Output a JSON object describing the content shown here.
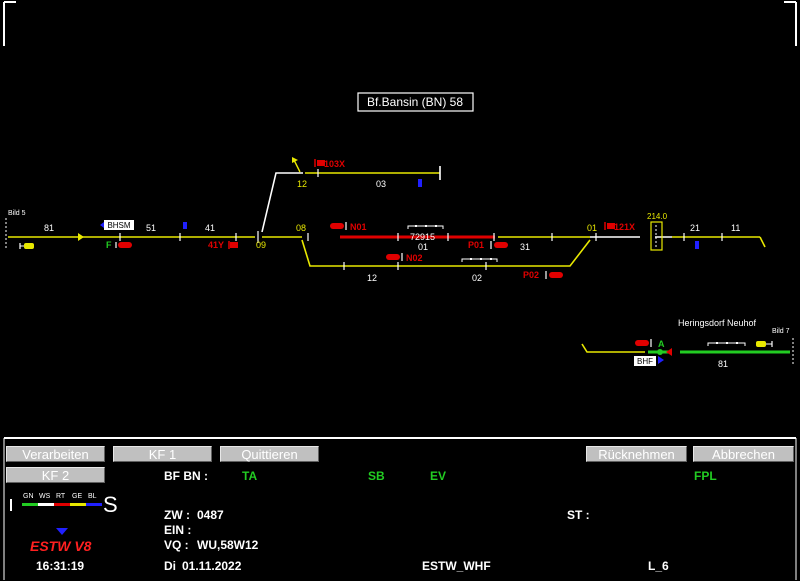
{
  "station_title": "Bf.Bansin (BN) 58",
  "bild_left": "Bild 5",
  "bild_right": "Bild 7",
  "heringsdorf_label": "Heringsdorf Neuhof",
  "track_numbers": {
    "t81": "81",
    "t51": "51",
    "t41": "41",
    "t09": "09",
    "t08": "08",
    "t12u": "12",
    "t03": "03",
    "t72915": "72915",
    "t01c": "01",
    "t31": "31",
    "t12l": "12",
    "t02": "02",
    "t01r": "01",
    "t214": "214.0",
    "t21": "21",
    "t11": "11",
    "t81r": "81"
  },
  "signals": {
    "s103x": "103X",
    "sn01": "N01",
    "sn02": "N02",
    "sp01": "P01",
    "sp02": "P02",
    "s41y": "41Y",
    "sf": "F",
    "s121x": "121X",
    "sa": "A"
  },
  "boxes": {
    "bhsm": "BHSM",
    "bhf": "BHF"
  },
  "buttons": {
    "verarbeiten": "Verarbeiten",
    "kf1": "KF 1",
    "quittieren": "Quittieren",
    "ruecknehmen": "Rücknehmen",
    "abbrechen": "Abbrechen",
    "kf2": "KF 2"
  },
  "status": {
    "bf_label": "BF BN :",
    "ta": "TA",
    "sb": "SB",
    "ev": "EV",
    "fpl": "FPL",
    "zw_label": "ZW :",
    "zw_value": "0487",
    "st_label": "ST :",
    "ein_label": "EIN :",
    "vq_label": "VQ :",
    "vq_value": "WU,58W12",
    "day": "Di",
    "date": "01.11.2022",
    "system": "ESTW_WHF",
    "level": "L_6",
    "time": "16:31:19",
    "brand": "ESTW V8",
    "s_letter": "S"
  },
  "legend": [
    "GN",
    "WS",
    "RT",
    "GE",
    "BL"
  ],
  "colors": {
    "track_yellow": "#e8e800",
    "route_red": "#e00000",
    "route_green": "#22cc22",
    "signal_blue": "#2020ff",
    "text_green": "#22cc22",
    "brand_red": "#ff2020"
  }
}
